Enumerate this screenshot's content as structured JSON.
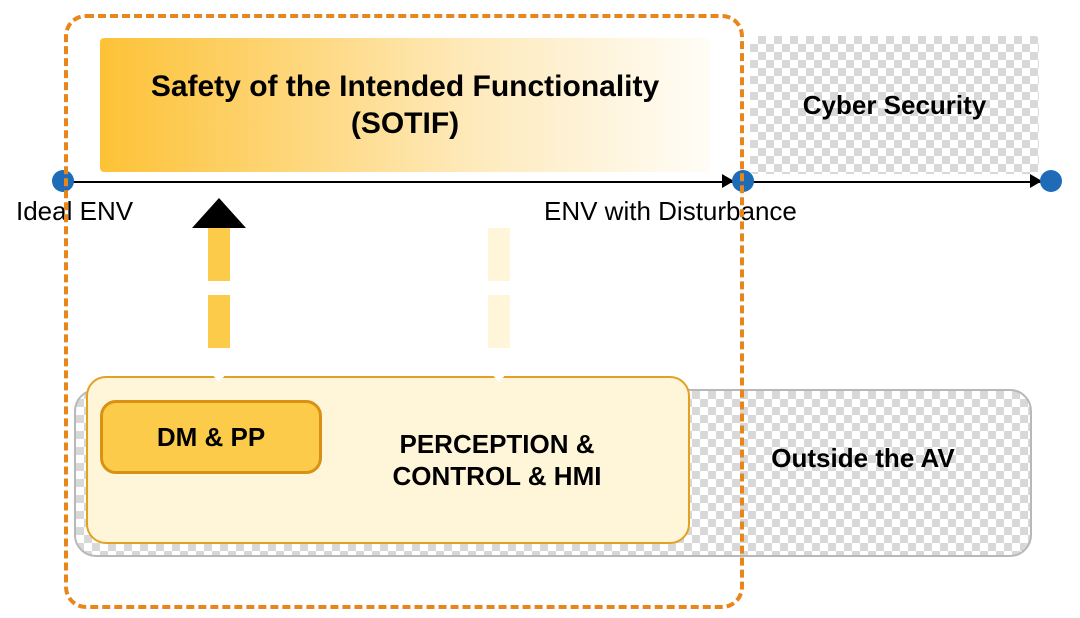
{
  "sotif": {
    "title_line1": "Safety of the Intended Functionality",
    "title_line2": "(SOTIF)"
  },
  "cyber": {
    "label": "Cyber Security"
  },
  "axis": {
    "left_label": "Ideal ENV",
    "mid_label": "ENV with Disturbance"
  },
  "lower": {
    "dmpp": "DM & PP",
    "perception_line1": "PERCEPTION &",
    "perception_line2": "CONTROL & HMI",
    "outside": "Outside the AV"
  },
  "diagram": {
    "arrows": [
      {
        "id": "arrow-up-left",
        "direction": "up",
        "fill": "yellow"
      },
      {
        "id": "arrow-down-left",
        "direction": "down",
        "fill": "yellow"
      },
      {
        "id": "arrow-up-right",
        "direction": "up",
        "fill": "cream"
      },
      {
        "id": "arrow-down-right",
        "direction": "down",
        "fill": "cream"
      }
    ],
    "axis_points": [
      {
        "id": "dot-left",
        "label_ref": "axis.left_label"
      },
      {
        "id": "dot-mid",
        "label_ref": "axis.mid_label"
      },
      {
        "id": "dot-right",
        "label_ref": null
      }
    ]
  }
}
